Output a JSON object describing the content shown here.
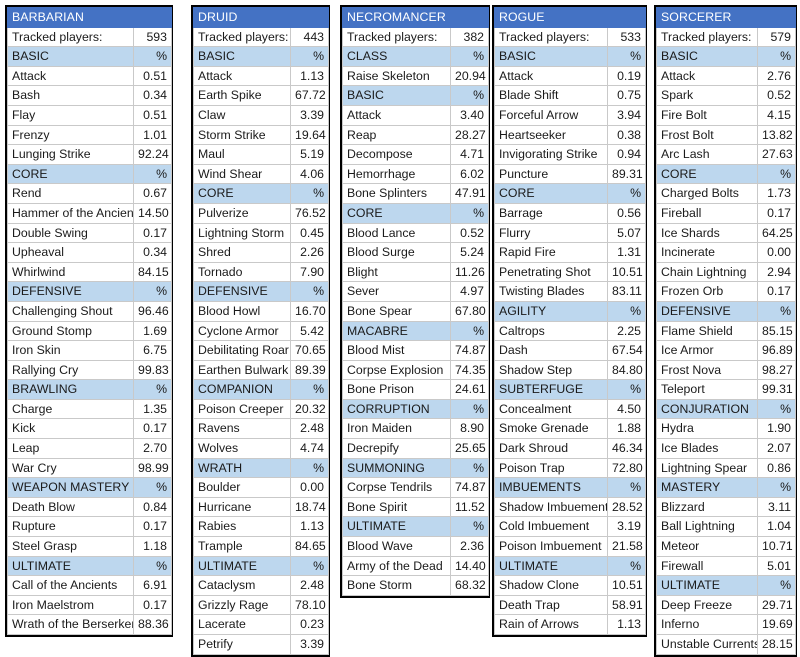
{
  "meta": {
    "tracked_label": "Tracked players:",
    "percent_symbol": "%"
  },
  "tables": [
    {
      "class_name": "BARBARIAN",
      "tracked_label": "Tracked players:",
      "tracked_value": "593",
      "rows": [
        {
          "type": "category",
          "label": "BASIC",
          "value": "%"
        },
        {
          "type": "skill",
          "label": "Attack",
          "value": "0.51"
        },
        {
          "type": "skill",
          "label": "Bash",
          "value": "0.34"
        },
        {
          "type": "skill",
          "label": "Flay",
          "value": "0.51"
        },
        {
          "type": "skill",
          "label": "Frenzy",
          "value": "1.01"
        },
        {
          "type": "skill",
          "label": "Lunging Strike",
          "value": "92.24"
        },
        {
          "type": "category",
          "label": "CORE",
          "value": "%"
        },
        {
          "type": "skill",
          "label": "Rend",
          "value": "0.67"
        },
        {
          "type": "skill",
          "label": "Hammer of the Ancients",
          "value": "14.50"
        },
        {
          "type": "skill",
          "label": "Double Swing",
          "value": "0.17"
        },
        {
          "type": "skill",
          "label": "Upheaval",
          "value": "0.34"
        },
        {
          "type": "skill",
          "label": "Whirlwind",
          "value": "84.15"
        },
        {
          "type": "category",
          "label": "DEFENSIVE",
          "value": "%"
        },
        {
          "type": "skill",
          "label": "Challenging Shout",
          "value": "96.46"
        },
        {
          "type": "skill",
          "label": "Ground Stomp",
          "value": "1.69"
        },
        {
          "type": "skill",
          "label": "Iron Skin",
          "value": "6.75"
        },
        {
          "type": "skill",
          "label": "Rallying Cry",
          "value": "99.83"
        },
        {
          "type": "category",
          "label": "BRAWLING",
          "value": "%"
        },
        {
          "type": "skill",
          "label": "Charge",
          "value": "1.35"
        },
        {
          "type": "skill",
          "label": "Kick",
          "value": "0.17"
        },
        {
          "type": "skill",
          "label": "Leap",
          "value": "2.70"
        },
        {
          "type": "skill",
          "label": "War Cry",
          "value": "98.99"
        },
        {
          "type": "category",
          "label": "WEAPON MASTERY",
          "value": "%"
        },
        {
          "type": "skill",
          "label": "Death Blow",
          "value": "0.84"
        },
        {
          "type": "skill",
          "label": "Rupture",
          "value": "0.17"
        },
        {
          "type": "skill",
          "label": "Steel Grasp",
          "value": "1.18"
        },
        {
          "type": "category",
          "label": "ULTIMATE",
          "value": "%"
        },
        {
          "type": "skill",
          "label": "Call of the Ancients",
          "value": "6.91"
        },
        {
          "type": "skill",
          "label": "Iron Maelstrom",
          "value": "0.17"
        },
        {
          "type": "skill",
          "label": "Wrath of the Berserker",
          "value": "88.36"
        }
      ]
    },
    {
      "class_name": "DRUID",
      "tracked_label": "Tracked players:",
      "tracked_value": "443",
      "rows": [
        {
          "type": "category",
          "label": "BASIC",
          "value": "%"
        },
        {
          "type": "skill",
          "label": "Attack",
          "value": "1.13"
        },
        {
          "type": "skill",
          "label": "Earth Spike",
          "value": "67.72"
        },
        {
          "type": "skill",
          "label": "Claw",
          "value": "3.39"
        },
        {
          "type": "skill",
          "label": "Storm Strike",
          "value": "19.64"
        },
        {
          "type": "skill",
          "label": "Maul",
          "value": "5.19"
        },
        {
          "type": "skill",
          "label": "Wind Shear",
          "value": "4.06"
        },
        {
          "type": "category",
          "label": "CORE",
          "value": "%"
        },
        {
          "type": "skill",
          "label": "Pulverize",
          "value": "76.52"
        },
        {
          "type": "skill",
          "label": "Lightning Storm",
          "value": "0.45"
        },
        {
          "type": "skill",
          "label": "Shred",
          "value": "2.26"
        },
        {
          "type": "skill",
          "label": "Tornado",
          "value": "7.90"
        },
        {
          "type": "category",
          "label": "DEFENSIVE",
          "value": "%"
        },
        {
          "type": "skill",
          "label": "Blood Howl",
          "value": "16.70"
        },
        {
          "type": "skill",
          "label": "Cyclone Armor",
          "value": "5.42"
        },
        {
          "type": "skill",
          "label": "Debilitating Roar",
          "value": "70.65"
        },
        {
          "type": "skill",
          "label": "Earthen Bulwark",
          "value": "89.39"
        },
        {
          "type": "category",
          "label": "COMPANION",
          "value": "%"
        },
        {
          "type": "skill",
          "label": "Poison Creeper",
          "value": "20.32"
        },
        {
          "type": "skill",
          "label": "Ravens",
          "value": "2.48"
        },
        {
          "type": "skill",
          "label": "Wolves",
          "value": "4.74"
        },
        {
          "type": "category",
          "label": "WRATH",
          "value": "%"
        },
        {
          "type": "skill",
          "label": "Boulder",
          "value": "0.00"
        },
        {
          "type": "skill",
          "label": "Hurricane",
          "value": "18.74"
        },
        {
          "type": "skill",
          "label": "Rabies",
          "value": "1.13"
        },
        {
          "type": "skill",
          "label": "Trample",
          "value": "84.65"
        },
        {
          "type": "category",
          "label": "ULTIMATE",
          "value": "%"
        },
        {
          "type": "skill",
          "label": "Cataclysm",
          "value": "2.48"
        },
        {
          "type": "skill",
          "label": "Grizzly Rage",
          "value": "78.10"
        },
        {
          "type": "skill",
          "label": "Lacerate",
          "value": "0.23"
        },
        {
          "type": "skill",
          "label": "Petrify",
          "value": "3.39"
        }
      ]
    },
    {
      "class_name": "NECROMANCER",
      "tracked_label": "Tracked players:",
      "tracked_value": "382",
      "rows": [
        {
          "type": "category",
          "label": "CLASS",
          "value": "%"
        },
        {
          "type": "skill",
          "label": "Raise Skeleton",
          "value": "20.94"
        },
        {
          "type": "category",
          "label": "BASIC",
          "value": "%"
        },
        {
          "type": "skill",
          "label": "Attack",
          "value": "3.40"
        },
        {
          "type": "skill",
          "label": "Reap",
          "value": "28.27"
        },
        {
          "type": "skill",
          "label": "Decompose",
          "value": "4.71"
        },
        {
          "type": "skill",
          "label": "Hemorrhage",
          "value": "6.02"
        },
        {
          "type": "skill",
          "label": "Bone Splinters",
          "value": "47.91"
        },
        {
          "type": "category",
          "label": "CORE",
          "value": "%"
        },
        {
          "type": "skill",
          "label": "Blood Lance",
          "value": "0.52"
        },
        {
          "type": "skill",
          "label": "Blood Surge",
          "value": "5.24"
        },
        {
          "type": "skill",
          "label": "Blight",
          "value": "11.26"
        },
        {
          "type": "skill",
          "label": "Sever",
          "value": "4.97"
        },
        {
          "type": "skill",
          "label": "Bone Spear",
          "value": "67.80"
        },
        {
          "type": "category",
          "label": "MACABRE",
          "value": "%"
        },
        {
          "type": "skill",
          "label": "Blood Mist",
          "value": "74.87"
        },
        {
          "type": "skill",
          "label": "Corpse Explosion",
          "value": "74.35"
        },
        {
          "type": "skill",
          "label": "Bone Prison",
          "value": "24.61"
        },
        {
          "type": "category",
          "label": "CORRUPTION",
          "value": "%"
        },
        {
          "type": "skill",
          "label": "Iron Maiden",
          "value": "8.90"
        },
        {
          "type": "skill",
          "label": "Decrepify",
          "value": "25.65"
        },
        {
          "type": "category",
          "label": "SUMMONING",
          "value": "%"
        },
        {
          "type": "skill",
          "label": "Corpse Tendrils",
          "value": "74.87"
        },
        {
          "type": "skill",
          "label": "Bone Spirit",
          "value": "11.52"
        },
        {
          "type": "category",
          "label": "ULTIMATE",
          "value": "%"
        },
        {
          "type": "skill",
          "label": "Blood Wave",
          "value": "2.36"
        },
        {
          "type": "skill",
          "label": "Army of the Dead",
          "value": "14.40"
        },
        {
          "type": "skill",
          "label": "Bone Storm",
          "value": "68.32"
        }
      ]
    },
    {
      "class_name": "ROGUE",
      "tracked_label": "Tracked players:",
      "tracked_value": "533",
      "rows": [
        {
          "type": "category",
          "label": "BASIC",
          "value": "%"
        },
        {
          "type": "skill",
          "label": "Attack",
          "value": "0.19"
        },
        {
          "type": "skill",
          "label": "Blade Shift",
          "value": "0.75"
        },
        {
          "type": "skill",
          "label": "Forceful Arrow",
          "value": "3.94"
        },
        {
          "type": "skill",
          "label": "Heartseeker",
          "value": "0.38"
        },
        {
          "type": "skill",
          "label": "Invigorating Strike",
          "value": "0.94"
        },
        {
          "type": "skill",
          "label": "Puncture",
          "value": "89.31"
        },
        {
          "type": "category",
          "label": "CORE",
          "value": "%"
        },
        {
          "type": "skill",
          "label": "Barrage",
          "value": "0.56"
        },
        {
          "type": "skill",
          "label": "Flurry",
          "value": "5.07"
        },
        {
          "type": "skill",
          "label": "Rapid Fire",
          "value": "1.31"
        },
        {
          "type": "skill",
          "label": "Penetrating Shot",
          "value": "10.51"
        },
        {
          "type": "skill",
          "label": "Twisting Blades",
          "value": "83.11"
        },
        {
          "type": "category",
          "label": "AGILITY",
          "value": "%"
        },
        {
          "type": "skill",
          "label": "Caltrops",
          "value": "2.25"
        },
        {
          "type": "skill",
          "label": "Dash",
          "value": "67.54"
        },
        {
          "type": "skill",
          "label": "Shadow Step",
          "value": "84.80"
        },
        {
          "type": "category",
          "label": "SUBTERFUGE",
          "value": "%"
        },
        {
          "type": "skill",
          "label": "Concealment",
          "value": "4.50"
        },
        {
          "type": "skill",
          "label": "Smoke Grenade",
          "value": "1.88"
        },
        {
          "type": "skill",
          "label": "Dark Shroud",
          "value": "46.34"
        },
        {
          "type": "skill",
          "label": "Poison Trap",
          "value": "72.80"
        },
        {
          "type": "category",
          "label": "IMBUEMENTS",
          "value": "%"
        },
        {
          "type": "skill",
          "label": "Shadow Imbuement",
          "value": "28.52"
        },
        {
          "type": "skill",
          "label": "Cold Imbuement",
          "value": "3.19"
        },
        {
          "type": "skill",
          "label": "Poison Imbuement",
          "value": "21.58"
        },
        {
          "type": "category",
          "label": "ULTIMATE",
          "value": "%"
        },
        {
          "type": "skill",
          "label": "Shadow Clone",
          "value": "10.51"
        },
        {
          "type": "skill",
          "label": "Death Trap",
          "value": "58.91"
        },
        {
          "type": "skill",
          "label": "Rain of Arrows",
          "value": "1.13"
        }
      ]
    },
    {
      "class_name": "SORCERER",
      "tracked_label": "Tracked players:",
      "tracked_value": "579",
      "rows": [
        {
          "type": "category",
          "label": "BASIC",
          "value": "%"
        },
        {
          "type": "skill",
          "label": "Attack",
          "value": "2.76"
        },
        {
          "type": "skill",
          "label": "Spark",
          "value": "0.52"
        },
        {
          "type": "skill",
          "label": "Fire Bolt",
          "value": "4.15"
        },
        {
          "type": "skill",
          "label": "Frost Bolt",
          "value": "13.82"
        },
        {
          "type": "skill",
          "label": "Arc Lash",
          "value": "27.63"
        },
        {
          "type": "category",
          "label": "CORE",
          "value": "%"
        },
        {
          "type": "skill",
          "label": "Charged Bolts",
          "value": "1.73"
        },
        {
          "type": "skill",
          "label": "Fireball",
          "value": "0.17"
        },
        {
          "type": "skill",
          "label": "Ice Shards",
          "value": "64.25"
        },
        {
          "type": "skill",
          "label": "Incinerate",
          "value": "0.00"
        },
        {
          "type": "skill",
          "label": "Chain Lightning",
          "value": "2.94"
        },
        {
          "type": "skill",
          "label": "Frozen Orb",
          "value": "0.17"
        },
        {
          "type": "category",
          "label": "DEFENSIVE",
          "value": "%"
        },
        {
          "type": "skill",
          "label": "Flame Shield",
          "value": "85.15"
        },
        {
          "type": "skill",
          "label": "Ice Armor",
          "value": "96.89"
        },
        {
          "type": "skill",
          "label": "Frost Nova",
          "value": "98.27"
        },
        {
          "type": "skill",
          "label": "Teleport",
          "value": "99.31"
        },
        {
          "type": "category",
          "label": "CONJURATION",
          "value": "%"
        },
        {
          "type": "skill",
          "label": "Hydra",
          "value": "1.90"
        },
        {
          "type": "skill",
          "label": "Ice Blades",
          "value": "2.07"
        },
        {
          "type": "skill",
          "label": "Lightning Spear",
          "value": "0.86"
        },
        {
          "type": "category",
          "label": "MASTERY",
          "value": "%"
        },
        {
          "type": "skill",
          "label": "Blizzard",
          "value": "3.11"
        },
        {
          "type": "skill",
          "label": "Ball Lightning",
          "value": "1.04"
        },
        {
          "type": "skill",
          "label": "Meteor",
          "value": "10.71"
        },
        {
          "type": "skill",
          "label": "Firewall",
          "value": "5.01"
        },
        {
          "type": "category",
          "label": "ULTIMATE",
          "value": "%"
        },
        {
          "type": "skill",
          "label": "Deep Freeze",
          "value": "29.71"
        },
        {
          "type": "skill",
          "label": "Inferno",
          "value": "19.69"
        },
        {
          "type": "skill",
          "label": "Unstable Currents",
          "value": "28.15"
        }
      ]
    }
  ],
  "colors": {
    "header_blue": "#4472C4",
    "category_blue": "#BDD7EE",
    "table_border": "#000000",
    "cell_border": "#C9C9C9",
    "text": "#1A1A1A",
    "header_text": "#FFFFFF",
    "background": "#FFFFFF"
  }
}
